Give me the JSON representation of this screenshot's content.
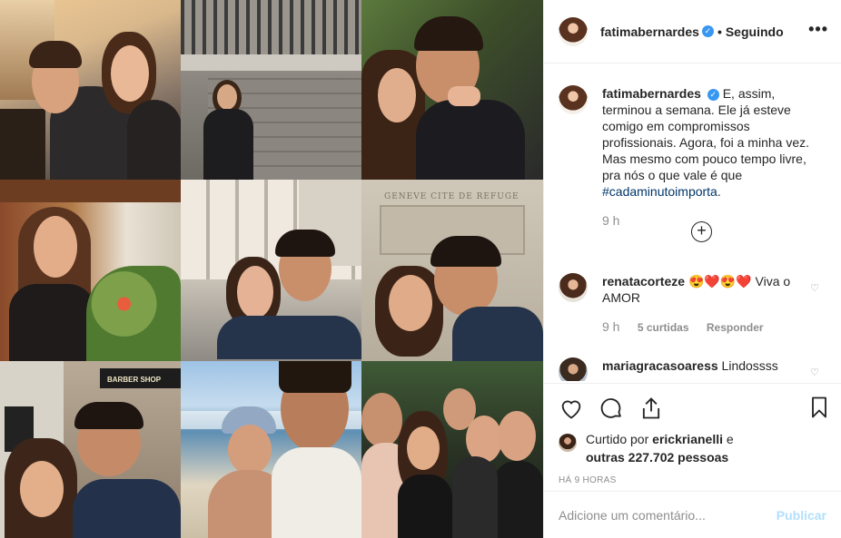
{
  "post": {
    "username": "fatimabernardes",
    "follow_label": "Seguindo",
    "more_label": "•••"
  },
  "caption": {
    "username": "fatimabernardes",
    "text": "E, assim, terminou a semana. Ele já esteve comigo em compromissos profissionais. Agora, foi a minha vez. Mas mesmo com pouco tempo livre, pra nós o que vale é que",
    "hashtag": "#cadaminutoimporta",
    "after_hashtag": ".",
    "time": "9 h"
  },
  "comments": [
    {
      "username": "renatacorteze",
      "emoji": "😍❤️😍❤️",
      "text": " Viva o AMOR",
      "time": "9 h",
      "likes": "5 curtidas",
      "reply": "Responder"
    },
    {
      "username": "mariagracasoaress",
      "text": "Lindossss"
    }
  ],
  "likes": {
    "prefix": "Curtido por",
    "user": "erickrianelli",
    "middle": "e",
    "others": "outras 227.702 pessoas"
  },
  "timestamp": "HÁ 9 HORAS",
  "add_comment": {
    "placeholder": "Adicione um comentário...",
    "publish": "Publicar"
  },
  "photos": {
    "barber_sign": "BARBER SHOP",
    "stone_sign": "GENEVE CITE DE REFUGE"
  },
  "icons": [
    "heart-icon",
    "comment-icon",
    "share-icon",
    "bookmark-icon",
    "more-icon",
    "verified-icon",
    "add-icon"
  ],
  "colors": {
    "link": "#003569",
    "verified": "#3897f0",
    "muted": "#8e8e8e",
    "publish": "#b2dffc"
  }
}
